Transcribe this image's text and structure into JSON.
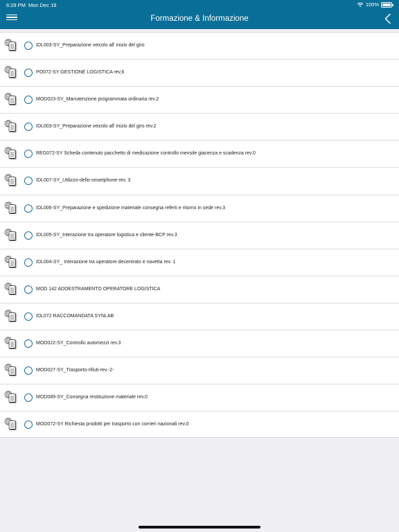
{
  "status_bar": {
    "time": "6:28 PM",
    "date": "Mon Dec 18",
    "battery": "100%",
    "battery_level": 1.0
  },
  "header": {
    "title": "Formazione & Informazione",
    "menu_icon": "hamburger-menu-icon",
    "back_icon": "chevron-left-icon"
  },
  "colors": {
    "header_bg": "#0a6f98",
    "radio_border": "#1b6f93",
    "page_bg": "#efeff4"
  },
  "list": {
    "items": [
      {
        "label": "IDL003-SY_Preparazione veicolo all' inizio del giro"
      },
      {
        "label": "PO072-SY GESTIONE LOGISTICA rev,6"
      },
      {
        "label": "MOD023-SY_Manutenzione programmata ordinaria rev.2"
      },
      {
        "label": "IDL003-SY_Preparazione veicolo all' inizio del giro rev.2"
      },
      {
        "label": "REG072-SY Scheda contenuto pacchetto di medicazione controllo mensile giacenza e scadenza rev.0"
      },
      {
        "label": "IDL007-SY_Utilizzo-dello-smartphone-rev. 3"
      },
      {
        "label": "IDL006-SY_Preparazione e spedizione materiale consegna referti e ritorno in sede rev.3"
      },
      {
        "label": "IDL005-SY_Interazione tra operatore logistica e cliente-BCP rev.3"
      },
      {
        "label": "IDL004-SY_ Interazione tra operatore decentrato e navetta rev. 1"
      },
      {
        "label": "MOD 142 ADDESTRAMENTO OPERATORE LOGISTICA"
      },
      {
        "label": "IDL072 RACCOMANDATA SYNLAB"
      },
      {
        "label": "MOD022-SY_Controllo automezzi rev.3"
      },
      {
        "label": "MOD027-SY_Trasporto-rifiuti-rev.-2-"
      },
      {
        "label": "MOD089-SY_Consegna restituzione materiale rev.0"
      },
      {
        "label": "MOD072-SY Richiesta prodotti per trasporto con corrieri nazionali rev.0"
      }
    ]
  }
}
